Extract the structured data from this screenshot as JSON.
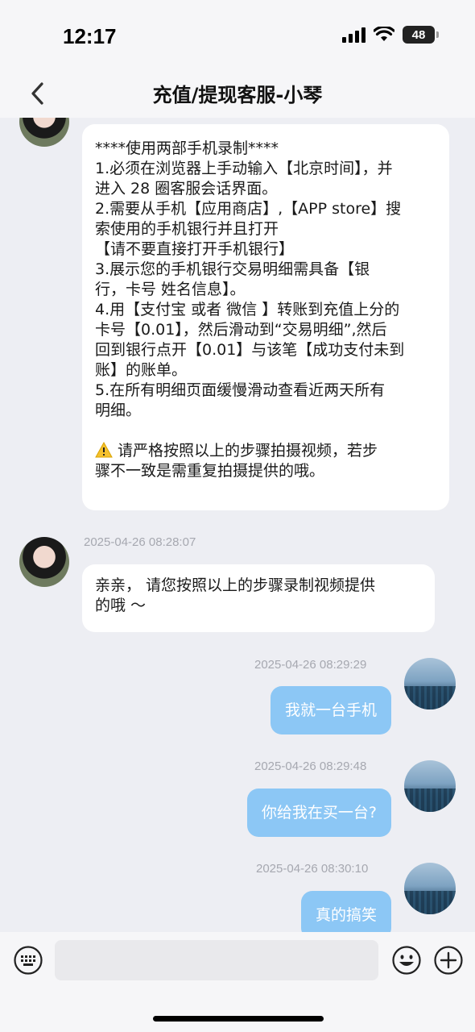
{
  "status_bar": {
    "time": "12:17",
    "battery": "48"
  },
  "header": {
    "title": "充值/提现客服-小琴"
  },
  "messages": {
    "m1": {
      "lines": [
        "****使用两部手机录制****",
        "1.必须在浏览器上手动输入【北京时间】，并",
        "进入 28 圈客服会话界面。",
        "2.需要从手机【应用商店】,【APP store】搜",
        "索使用的手机银行并且打开",
        "【请不要直接打开手机银行】",
        "3.展示您的手机银行交易明细需具备【银",
        "行，卡号 姓名信息】。",
        "4.用【支付宝 或者 微信 】转账到充值上分的",
        "卡号【0.01】，然后滑动到“交易明细”,然后",
        "回到银行点开【0.01】与该笔【成功支付未到",
        "账】的账单。",
        "5.在所有明细页面缓慢滑动查看近两天所有",
        "明细。",
        "",
        "请严格按照以上的步骤拍摄视频，若步",
        "骤不一致是需重复拍摄提供的哦。"
      ]
    },
    "m2": {
      "time": "2025-04-26 08:28:07",
      "lines": [
        "亲亲， 请您按照以上的步骤录制视频提供",
        "的哦 ～"
      ]
    },
    "m3": {
      "time": "2025-04-26 08:29:29",
      "text": "我就一台手机"
    },
    "m4": {
      "time": "2025-04-26 08:29:48",
      "text": "你给我在买一台?"
    },
    "m5": {
      "time": "2025-04-26 08:30:10",
      "text": "真的搞笑"
    }
  },
  "input": {
    "placeholder": ""
  },
  "icons": {
    "back": "chevron-left-icon",
    "keyboard": "keyboard-icon",
    "emoji": "emoji-icon",
    "plus": "plus-icon",
    "warning": "warning-icon"
  },
  "colors": {
    "out_bubble": "#8cc7f5",
    "background": "#edeef3"
  }
}
